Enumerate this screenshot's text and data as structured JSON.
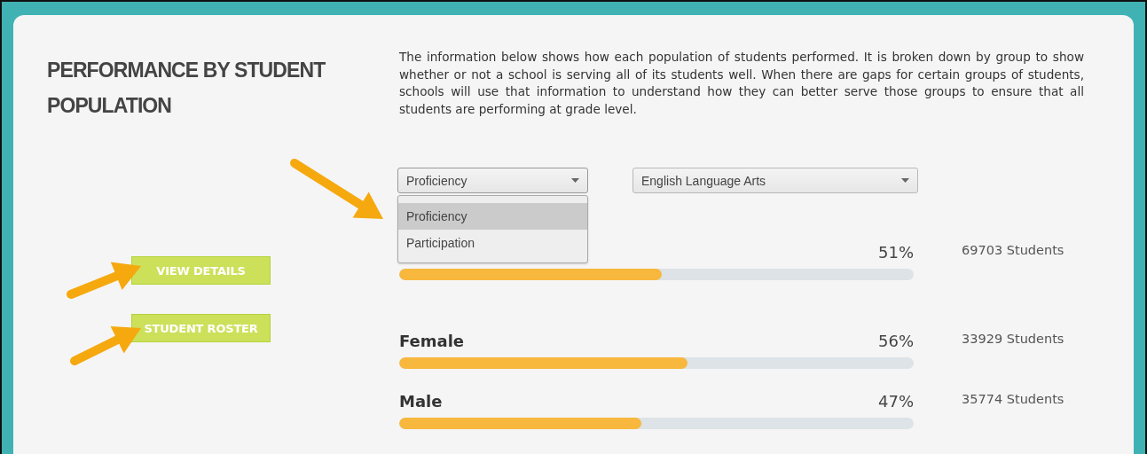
{
  "title": "PERFORMANCE BY STUDENT POPULATION",
  "description": "The information below shows how each population of students performed. It is broken down by group to show whether or not a school is serving all of its students well. When there are gaps for certain groups of students, schools will use that information to understand how they can better serve those groups to ensure that all students are performing at grade level.",
  "buttons": [
    "VIEW DETAILS",
    "STUDENT ROSTER"
  ],
  "dropdowns": [
    {
      "value": "Proficiency",
      "expanded": true,
      "options": [
        {
          "label": "Proficiency",
          "selected": true
        },
        {
          "label": "Participation",
          "selected": false
        }
      ]
    },
    {
      "value": "English Language Arts",
      "expanded": false
    }
  ],
  "rows": [
    {
      "percent": "51%",
      "level": 0.51,
      "students": "69703 Students"
    },
    {
      "name": "Female",
      "percent": "56%",
      "level": 0.56,
      "students": "33929 Students"
    },
    {
      "name": "Male",
      "percent": "47%",
      "level": 0.47,
      "students": "35774 Students"
    }
  ]
}
